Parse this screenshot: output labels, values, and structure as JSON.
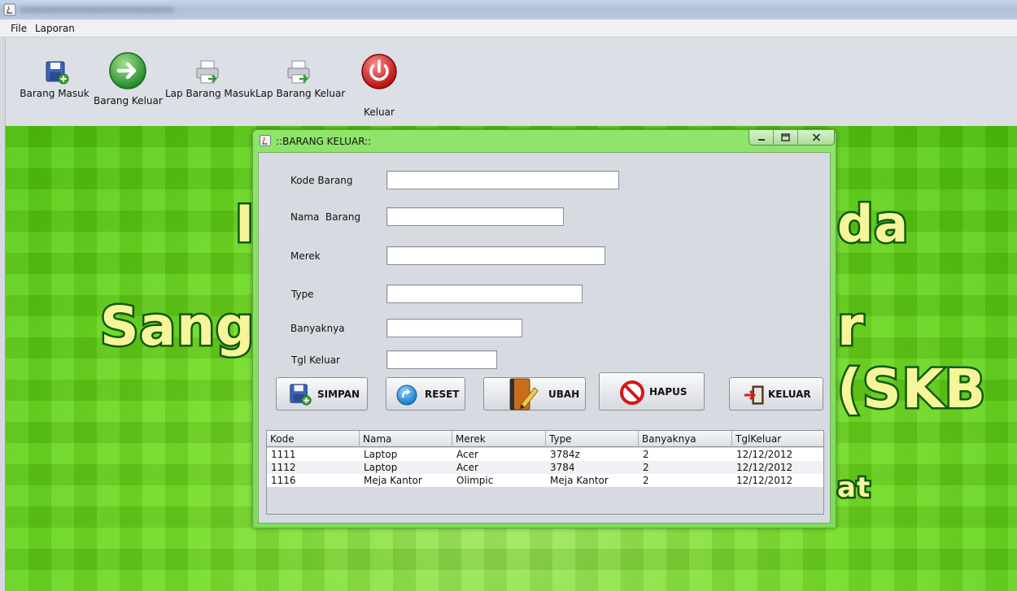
{
  "colors": {
    "desktop_green": "#6fdc1e",
    "banner_text": "#f6f59a",
    "banner_stroke": "#0f5a10",
    "frame_green": "#8fe56a"
  },
  "menu": {
    "items": [
      "File",
      "Laporan"
    ]
  },
  "toolbar": {
    "items": [
      {
        "label": "Barang Masuk",
        "icon": "save-add-icon"
      },
      {
        "label": "Barang Keluar",
        "icon": "arrow-right-icon"
      },
      {
        "label": "Lap Barang Masuk",
        "icon": "printer-icon"
      },
      {
        "label": "Lap Barang Keluar",
        "icon": "printer-icon"
      },
      {
        "label": "Keluar",
        "icon": "power-icon"
      }
    ]
  },
  "frame": {
    "title": "::BARANG KELUAR::",
    "controls": [
      "minimize",
      "maximize",
      "close"
    ]
  },
  "form": {
    "fields": [
      {
        "label": "Kode Barang",
        "value": ""
      },
      {
        "label": "Nama  Barang",
        "value": ""
      },
      {
        "label": "Merek",
        "value": ""
      },
      {
        "label": "Type",
        "value": ""
      },
      {
        "label": "Banyaknya",
        "value": ""
      },
      {
        "label": "Tgl Keluar",
        "value": ""
      }
    ],
    "buttons": [
      {
        "label": "SIMPAN",
        "icon": "save-add-icon"
      },
      {
        "label": "RESET",
        "icon": "refresh-icon"
      },
      {
        "label": "UBAH",
        "icon": "edit-book-icon"
      },
      {
        "label": "HAPUS",
        "icon": "no-entry-icon"
      },
      {
        "label": "KELUAR",
        "icon": "exit-door-icon"
      }
    ]
  },
  "table": {
    "columns": [
      "Kode",
      "Nama",
      "Merek",
      "Type",
      "Banyaknya",
      "TglKeluar"
    ],
    "rows": [
      [
        "1111",
        "Laptop",
        "Acer",
        "3784z",
        "2",
        "12/12/2012"
      ],
      [
        "1112",
        "Laptop",
        "Acer",
        "3784",
        "2",
        "12/12/2012"
      ],
      [
        "1116",
        "Meja Kantor",
        "Olimpic",
        "Meja Kantor",
        "2",
        "12/12/2012"
      ]
    ]
  }
}
